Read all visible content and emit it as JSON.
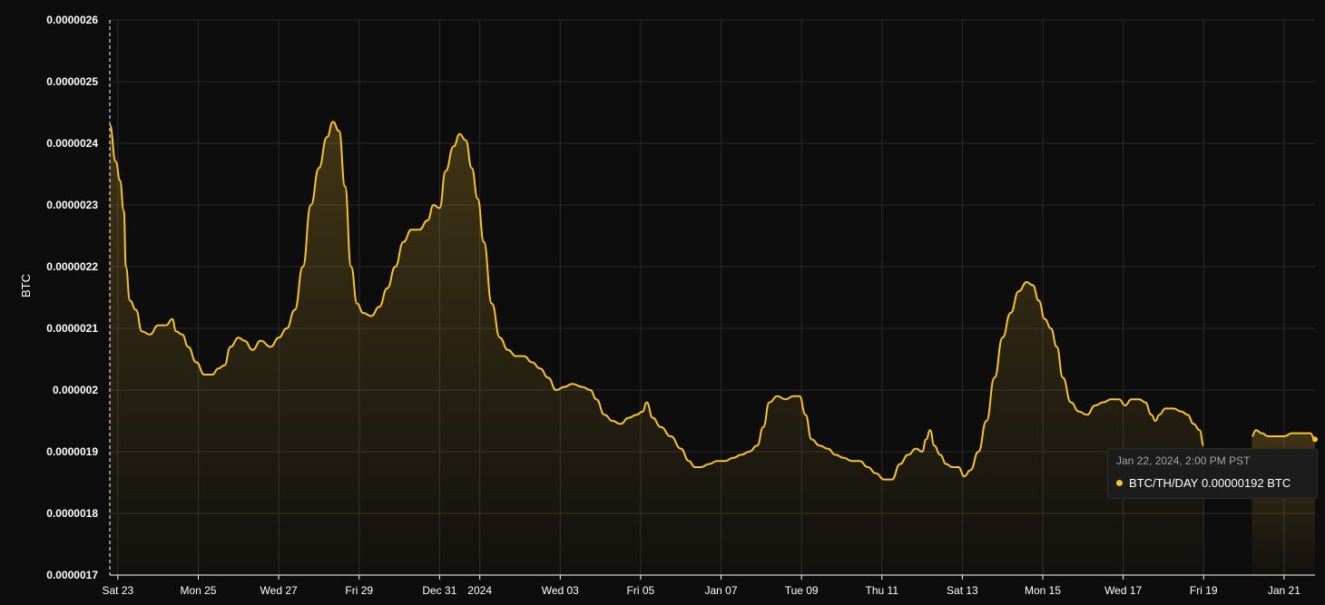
{
  "chart_data": {
    "type": "area",
    "ylabel": "BTC",
    "ylim": [
      1.7e-06,
      2.6e-06
    ],
    "yticks": [
      "0.0000026",
      "0.0000025",
      "0.0000024",
      "0.0000023",
      "0.0000022",
      "0.0000021",
      "0.000002",
      "0.0000019",
      "0.0000018",
      "0.0000017"
    ],
    "yticks_values": [
      2.6e-06,
      2.5e-06,
      2.4e-06,
      2.3e-06,
      2.2e-06,
      2.1e-06,
      2e-06,
      1.9e-06,
      1.8e-06,
      1.7e-06
    ],
    "xticks": [
      "Sat 23",
      "Mon 25",
      "Wed 27",
      "Fri 29",
      "Dec 31",
      "2024",
      "Wed 03",
      "Fri 05",
      "Jan 07",
      "Tue 09",
      "Thu 11",
      "Sat 13",
      "Mon 15",
      "Wed 17",
      "Fri 19",
      "Jan 21"
    ],
    "xticks_days": [
      1,
      3,
      5,
      7,
      9,
      10,
      12,
      14,
      16,
      18,
      20,
      22,
      24,
      26,
      28,
      30
    ],
    "xlim_days": [
      0.8,
      30.77
    ],
    "x_unit": "days since Dec 22, 2023 00:00",
    "grid": true,
    "color": "#f7c132",
    "series": [
      {
        "name": "BTC/TH/DAY",
        "points": [
          [
            0.8,
            2.43e-06
          ],
          [
            0.95,
            2.37e-06
          ],
          [
            1.05,
            2.34e-06
          ],
          [
            1.15,
            2.29e-06
          ],
          [
            1.2,
            2.2e-06
          ],
          [
            1.3,
            2.145e-06
          ],
          [
            1.45,
            2.13e-06
          ],
          [
            1.6,
            2.095e-06
          ],
          [
            1.8,
            2.09e-06
          ],
          [
            2.0,
            2.105e-06
          ],
          [
            2.2,
            2.105e-06
          ],
          [
            2.35,
            2.115e-06
          ],
          [
            2.45,
            2.095e-06
          ],
          [
            2.6,
            2.09e-06
          ],
          [
            2.75,
            2.07e-06
          ],
          [
            2.95,
            2.045e-06
          ],
          [
            3.15,
            2.025e-06
          ],
          [
            3.35,
            2.025e-06
          ],
          [
            3.5,
            2.035e-06
          ],
          [
            3.65,
            2.04e-06
          ],
          [
            3.8,
            2.07e-06
          ],
          [
            4.0,
            2.085e-06
          ],
          [
            4.15,
            2.08e-06
          ],
          [
            4.35,
            2.065e-06
          ],
          [
            4.55,
            2.08e-06
          ],
          [
            4.8,
            2.07e-06
          ],
          [
            5.0,
            2.085e-06
          ],
          [
            5.2,
            2.1e-06
          ],
          [
            5.4,
            2.13e-06
          ],
          [
            5.6,
            2.2e-06
          ],
          [
            5.8,
            2.3e-06
          ],
          [
            6.0,
            2.36e-06
          ],
          [
            6.2,
            2.41e-06
          ],
          [
            6.35,
            2.435e-06
          ],
          [
            6.5,
            2.42e-06
          ],
          [
            6.65,
            2.33e-06
          ],
          [
            6.8,
            2.2e-06
          ],
          [
            6.95,
            2.14e-06
          ],
          [
            7.1,
            2.125e-06
          ],
          [
            7.3,
            2.12e-06
          ],
          [
            7.5,
            2.135e-06
          ],
          [
            7.7,
            2.165e-06
          ],
          [
            7.9,
            2.2e-06
          ],
          [
            8.1,
            2.24e-06
          ],
          [
            8.3,
            2.26e-06
          ],
          [
            8.5,
            2.26e-06
          ],
          [
            8.7,
            2.275e-06
          ],
          [
            8.85,
            2.3e-06
          ],
          [
            9.0,
            2.295e-06
          ],
          [
            9.15,
            2.355e-06
          ],
          [
            9.35,
            2.395e-06
          ],
          [
            9.5,
            2.415e-06
          ],
          [
            9.65,
            2.405e-06
          ],
          [
            9.8,
            2.36e-06
          ],
          [
            9.95,
            2.31e-06
          ],
          [
            10.1,
            2.24e-06
          ],
          [
            10.3,
            2.14e-06
          ],
          [
            10.5,
            2.085e-06
          ],
          [
            10.7,
            2.065e-06
          ],
          [
            10.9,
            2.055e-06
          ],
          [
            11.1,
            2.055e-06
          ],
          [
            11.3,
            2.045e-06
          ],
          [
            11.5,
            2.035e-06
          ],
          [
            11.7,
            2.02e-06
          ],
          [
            11.9,
            2e-06
          ],
          [
            12.1,
            2.005e-06
          ],
          [
            12.3,
            2.01e-06
          ],
          [
            12.55,
            2.005e-06
          ],
          [
            12.75,
            2e-06
          ],
          [
            12.9,
            1.985e-06
          ],
          [
            13.1,
            1.96e-06
          ],
          [
            13.3,
            1.95e-06
          ],
          [
            13.5,
            1.945e-06
          ],
          [
            13.7,
            1.955e-06
          ],
          [
            13.9,
            1.96e-06
          ],
          [
            14.05,
            1.965e-06
          ],
          [
            14.15,
            1.98e-06
          ],
          [
            14.3,
            1.955e-06
          ],
          [
            14.5,
            1.94e-06
          ],
          [
            14.75,
            1.925e-06
          ],
          [
            15.0,
            1.905e-06
          ],
          [
            15.2,
            1.885e-06
          ],
          [
            15.35,
            1.875e-06
          ],
          [
            15.5,
            1.875e-06
          ],
          [
            15.7,
            1.88e-06
          ],
          [
            15.9,
            1.885e-06
          ],
          [
            16.1,
            1.885e-06
          ],
          [
            16.3,
            1.89e-06
          ],
          [
            16.5,
            1.895e-06
          ],
          [
            16.7,
            1.9e-06
          ],
          [
            16.9,
            1.91e-06
          ],
          [
            17.05,
            1.94e-06
          ],
          [
            17.2,
            1.98e-06
          ],
          [
            17.4,
            1.99e-06
          ],
          [
            17.6,
            1.985e-06
          ],
          [
            17.8,
            1.99e-06
          ],
          [
            17.95,
            1.99e-06
          ],
          [
            18.1,
            1.96e-06
          ],
          [
            18.25,
            1.92e-06
          ],
          [
            18.45,
            1.91e-06
          ],
          [
            18.65,
            1.905e-06
          ],
          [
            18.85,
            1.895e-06
          ],
          [
            19.05,
            1.89e-06
          ],
          [
            19.25,
            1.885e-06
          ],
          [
            19.45,
            1.885e-06
          ],
          [
            19.65,
            1.875e-06
          ],
          [
            19.85,
            1.865e-06
          ],
          [
            20.05,
            1.855e-06
          ],
          [
            20.25,
            1.855e-06
          ],
          [
            20.45,
            1.88e-06
          ],
          [
            20.65,
            1.895e-06
          ],
          [
            20.85,
            1.905e-06
          ],
          [
            21.0,
            1.9e-06
          ],
          [
            21.1,
            1.92e-06
          ],
          [
            21.2,
            1.935e-06
          ],
          [
            21.3,
            1.91e-06
          ],
          [
            21.45,
            1.895e-06
          ],
          [
            21.6,
            1.88e-06
          ],
          [
            21.75,
            1.875e-06
          ],
          [
            21.9,
            1.875e-06
          ],
          [
            22.05,
            1.86e-06
          ],
          [
            22.2,
            1.87e-06
          ],
          [
            22.4,
            1.9e-06
          ],
          [
            22.6,
            1.95e-06
          ],
          [
            22.8,
            2.02e-06
          ],
          [
            23.0,
            2.085e-06
          ],
          [
            23.2,
            2.125e-06
          ],
          [
            23.4,
            2.16e-06
          ],
          [
            23.6,
            2.175e-06
          ],
          [
            23.75,
            2.17e-06
          ],
          [
            23.9,
            2.145e-06
          ],
          [
            24.05,
            2.115e-06
          ],
          [
            24.2,
            2.1e-06
          ],
          [
            24.35,
            2.07e-06
          ],
          [
            24.5,
            2.02e-06
          ],
          [
            24.7,
            1.98e-06
          ],
          [
            24.9,
            1.965e-06
          ],
          [
            25.1,
            1.96e-06
          ],
          [
            25.3,
            1.975e-06
          ],
          [
            25.5,
            1.98e-06
          ],
          [
            25.7,
            1.985e-06
          ],
          [
            25.9,
            1.985e-06
          ],
          [
            26.05,
            1.975e-06
          ],
          [
            26.2,
            1.985e-06
          ],
          [
            26.4,
            1.985e-06
          ],
          [
            26.55,
            1.98e-06
          ],
          [
            26.7,
            1.96e-06
          ],
          [
            26.8,
            1.95e-06
          ],
          [
            26.9,
            1.96e-06
          ],
          [
            27.05,
            1.97e-06
          ],
          [
            27.25,
            1.97e-06
          ],
          [
            27.45,
            1.965e-06
          ],
          [
            27.6,
            1.96e-06
          ],
          [
            27.75,
            1.945e-06
          ],
          [
            27.9,
            1.935e-06
          ],
          [
            28.0,
            1.91e-06
          ]
        ]
      },
      {
        "name": "BTC/TH/DAY",
        "points": [
          [
            29.2,
            1.925e-06
          ],
          [
            29.3,
            1.935e-06
          ],
          [
            29.45,
            1.93e-06
          ],
          [
            29.6,
            1.925e-06
          ],
          [
            29.8,
            1.925e-06
          ],
          [
            30.0,
            1.925e-06
          ],
          [
            30.2,
            1.93e-06
          ],
          [
            30.4,
            1.93e-06
          ],
          [
            30.55,
            1.93e-06
          ],
          [
            30.65,
            1.93e-06
          ],
          [
            30.77,
            1.92e-06
          ]
        ]
      }
    ]
  },
  "tooltip": {
    "date": "Jan 22, 2024, 2:00 PM PST",
    "series_label": "BTC/TH/DAY",
    "value": "0.00000192 BTC",
    "dot_color": "#f7c132"
  }
}
